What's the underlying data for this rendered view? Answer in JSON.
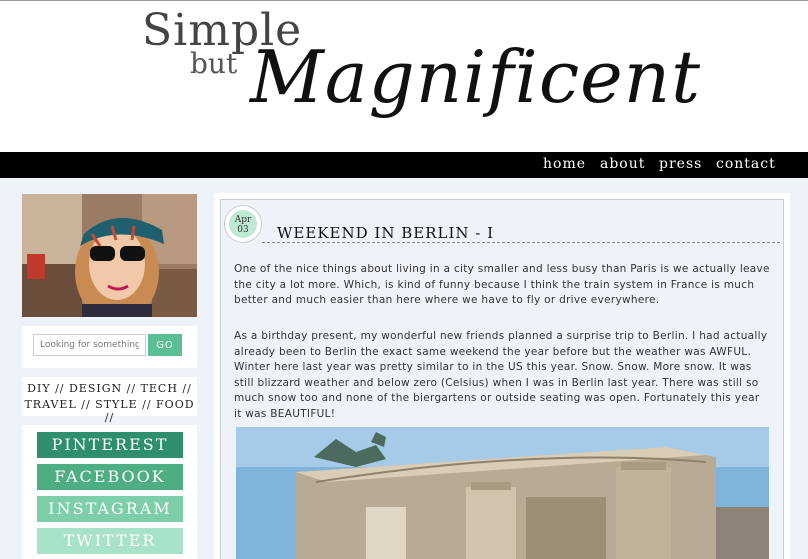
{
  "header": {
    "logo_simple": "Simple",
    "logo_but": "but",
    "logo_magnificent": "Magnificent"
  },
  "nav": {
    "items": [
      "home",
      "about",
      "press",
      "contact"
    ]
  },
  "sidebar": {
    "search": {
      "placeholder": "Looking for something?",
      "button": "GO"
    },
    "categories": {
      "line1": "DIY // DESIGN // TECH //",
      "line2": "TRAVEL // STYLE // FOOD //"
    },
    "social": [
      {
        "label": "PINTEREST",
        "color": "#2e8f6c"
      },
      {
        "label": "FACEBOOK",
        "color": "#4dae82"
      },
      {
        "label": "INSTAGRAM",
        "color": "#7ccfa9"
      },
      {
        "label": "TWITTER",
        "color": "#a8e2c8"
      }
    ]
  },
  "post": {
    "date_month": "Apr",
    "date_day": "03",
    "title": "WEEKEND IN BERLIN - I",
    "paragraphs": [
      "One of the nice things about living in a city smaller and less busy than Paris is we actually leave the city a lot more. Which, is kind of funny because I think the train system in France is much better and much easier than here where we have to fly or drive everywhere.",
      "As a birthday present, my wonderful new friends planned a surprise trip to Berlin. I had actually already been to Berlin the exact same weekend the year before but the weather was AWFUL. Winter here last year was pretty similar to in the US this year. Snow. Snow. More snow. It was still blizzard weather and below zero (Celsius) when I was in Berlin last year. There was still so much snow too and none of the biergartens or outside seating was open. Fortunately this year it was BEAUTIFUL!"
    ]
  },
  "colors": {
    "accent": "#5bbf95",
    "background": "#eef2f9",
    "navbar": "#000000"
  }
}
